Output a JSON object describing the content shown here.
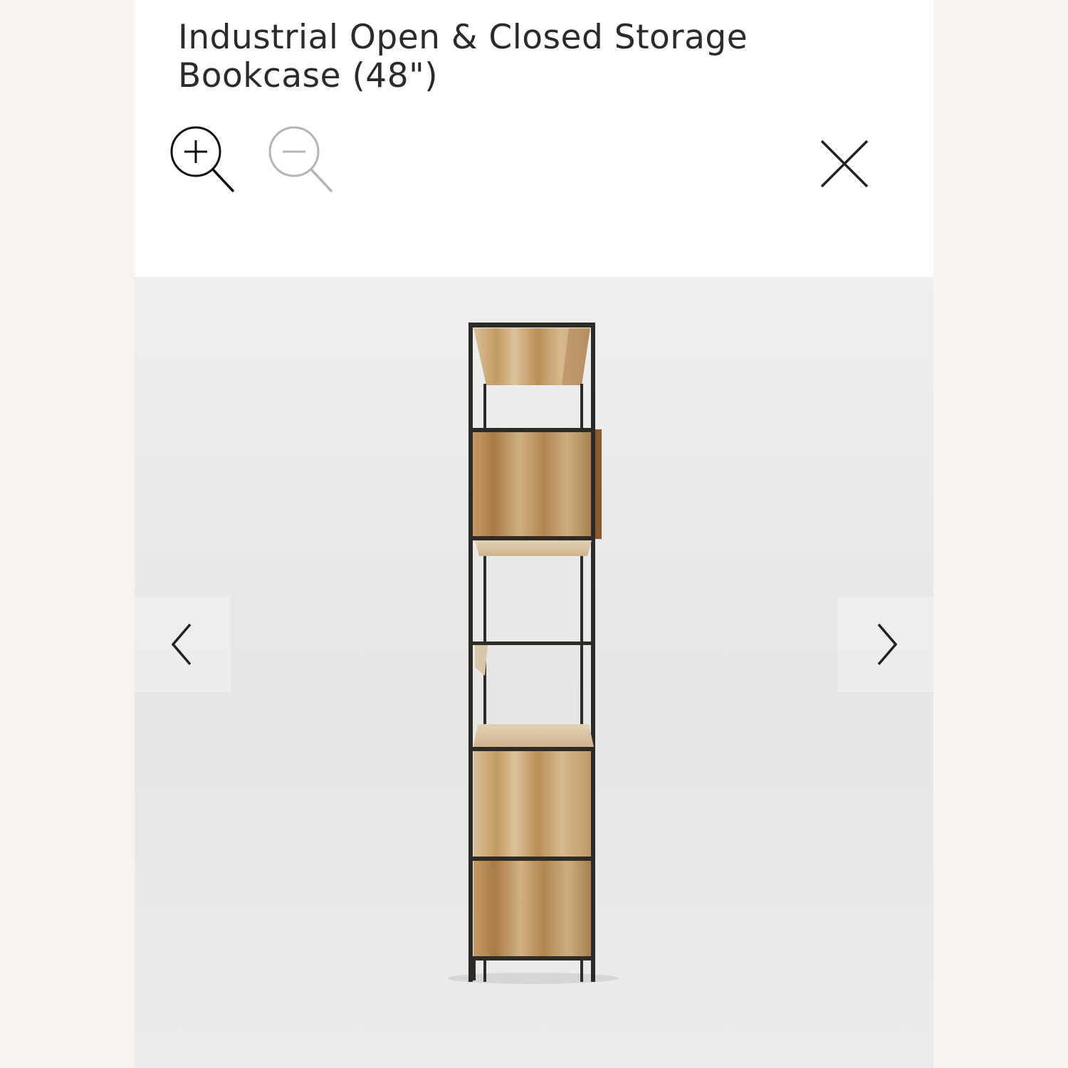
{
  "product": {
    "title": "Industrial Open & Closed Storage Bookcase (48\")"
  },
  "toolbar": {
    "zoom_in_icon": "zoom-in-icon",
    "zoom_out_icon": "zoom-out-icon",
    "close_icon": "close-icon",
    "zoom_out_enabled": false
  },
  "gallery": {
    "prev_icon": "chevron-left-icon",
    "next_icon": "chevron-right-icon",
    "image": "bookcase-side-view"
  },
  "colors": {
    "page_bg": "#f7f3f1",
    "panel_bg": "#ffffff",
    "title_text": "#2b2b2b",
    "icon_active": "#111111",
    "icon_disabled": "#b5b5b5",
    "viewer_bg": "#eaeaea",
    "metal_frame": "#2e2a26",
    "wood": "#c8a77a"
  }
}
